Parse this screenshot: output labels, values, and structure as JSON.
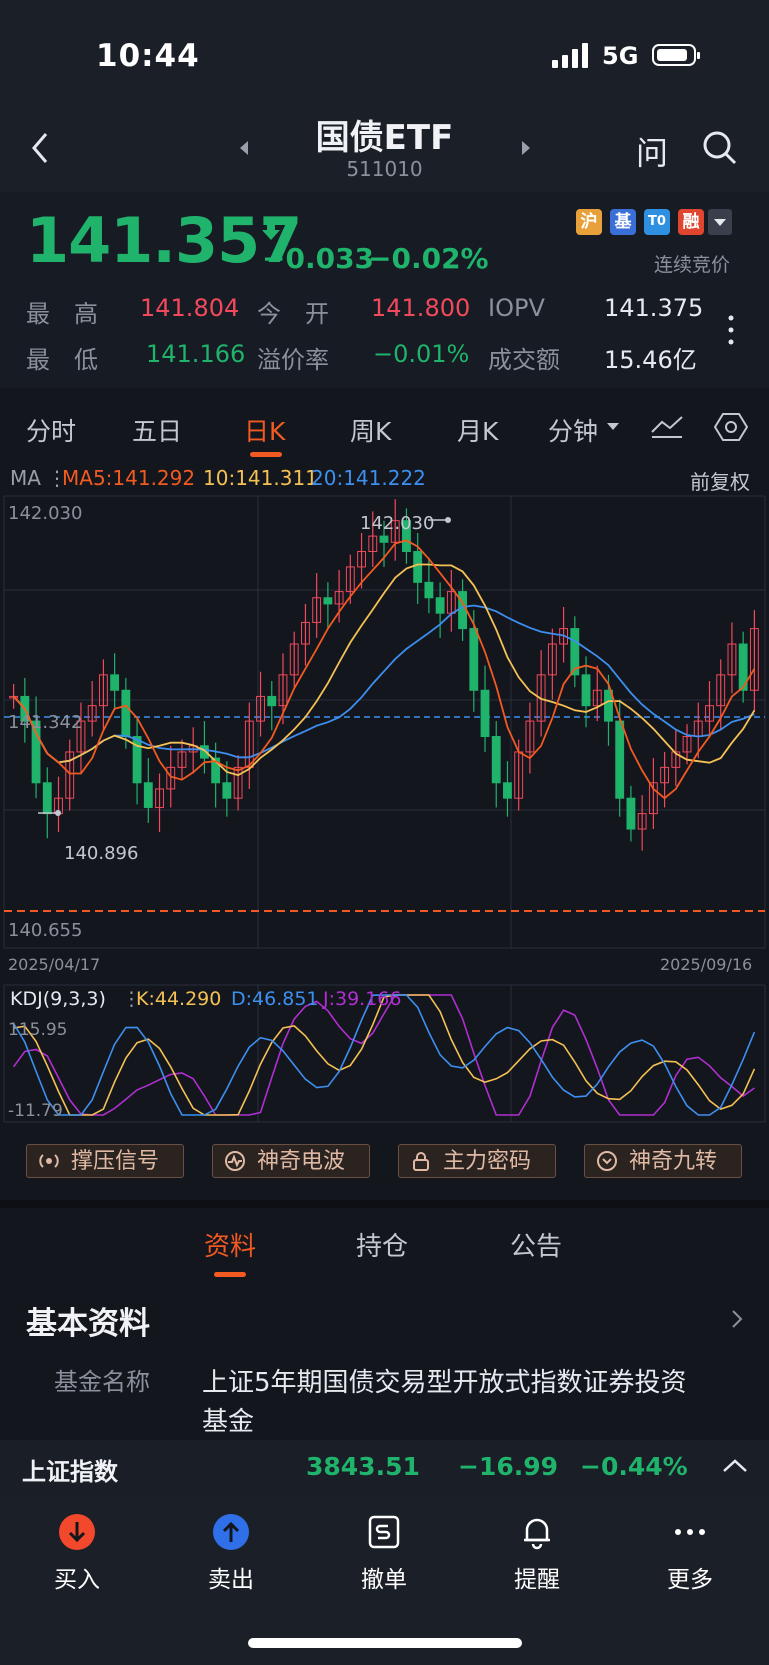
{
  "status": {
    "time": "10:44",
    "network": "5G"
  },
  "header": {
    "title": "国债ETF",
    "code": "511010",
    "ask_icon": "问",
    "search_icon": "search-icon"
  },
  "quote": {
    "price": "141.357",
    "change": "−0.033",
    "change_pct": "−0.02%",
    "badges": [
      "沪",
      "基",
      "T0",
      "融"
    ],
    "auction_label": "连续竞价",
    "stats": [
      {
        "label": "最　高",
        "value": "141.804",
        "color": "#f2495c"
      },
      {
        "label": "今　开",
        "value": "141.800",
        "color": "#f2495c"
      },
      {
        "label": "IOPV",
        "value": "141.375",
        "color": "#e6e9ef"
      },
      {
        "label": "最　低",
        "value": "141.166",
        "color": "#1fb36b"
      },
      {
        "label": "溢价率",
        "value": "−0.01%",
        "color": "#1fb36b"
      },
      {
        "label": "成交额",
        "value": "15.46亿",
        "color": "#e6e9ef"
      }
    ]
  },
  "period_tabs": [
    "分时",
    "五日",
    "日K",
    "周K",
    "月K",
    "分钟"
  ],
  "active_period": "日K",
  "ma_legend": {
    "label": "MA",
    "ma5": "MA5:141.292",
    "ma10": "10:141.311",
    "ma20": "20:141.222",
    "adjust": "前复权"
  },
  "kline": {
    "top_price": "142.030",
    "mid_price": "141.342",
    "bottom_price": "140.655",
    "high_marker": "142.030",
    "low_marker": "140.896",
    "start_date": "2025/04/17",
    "end_date": "2025/09/16"
  },
  "kdj_legend": {
    "label": "KDJ(9,3,3)",
    "k": "K:44.290",
    "d": "D:46.851",
    "j": "J:39.166",
    "top": "115.95",
    "bottom": "-11.79"
  },
  "signal_buttons": [
    "撑压信号",
    "神奇电波",
    "主力密码",
    "神奇九转"
  ],
  "info_tabs": [
    "资料",
    "持仓",
    "公告"
  ],
  "basic_info": {
    "heading": "基本资料",
    "fund_name_label": "基金名称",
    "fund_name_line1": "上证5年期国债交易型开放式指数证券投资",
    "fund_name_line2": "基金"
  },
  "index_bar": {
    "name": "上证指数",
    "value": "3843.51",
    "change": "−16.99",
    "pct": "−0.44%"
  },
  "bottom_nav": [
    "买入",
    "卖出",
    "撤单",
    "提醒",
    "更多"
  ],
  "chart_data": {
    "type": "candlestick",
    "xlabel": "",
    "ylabel": "",
    "x_range": [
      "2025/04/17",
      "2025/09/16"
    ],
    "ylim": [
      140.655,
      142.03
    ],
    "reference_line": 141.342,
    "marked_high": 142.03,
    "marked_low": 140.896,
    "close_series": [
      141.38,
      141.3,
      141.1,
      141.0,
      141.05,
      141.2,
      141.3,
      141.35,
      141.45,
      141.4,
      141.25,
      141.1,
      141.02,
      141.08,
      141.15,
      141.2,
      141.22,
      141.18,
      141.1,
      141.05,
      141.15,
      141.3,
      141.38,
      141.35,
      141.45,
      141.55,
      141.62,
      141.7,
      141.68,
      141.72,
      141.8,
      141.85,
      141.9,
      141.88,
      141.95,
      141.85,
      141.75,
      141.7,
      141.65,
      141.72,
      141.6,
      141.4,
      141.25,
      141.1,
      141.05,
      141.2,
      141.3,
      141.45,
      141.55,
      141.6,
      141.45,
      141.35,
      141.4,
      141.3,
      141.05,
      140.95,
      141.0,
      141.1,
      141.15,
      141.2,
      141.25,
      141.3,
      141.35,
      141.45,
      141.55,
      141.4,
      141.6
    ],
    "ma": [
      {
        "name": "MA5",
        "value": 141.292,
        "color": "#f25a22"
      },
      {
        "name": "10",
        "value": 141.311,
        "color": "#f5c155"
      },
      {
        "name": "20",
        "value": 141.222,
        "color": "#3d8ff0"
      }
    ],
    "kdj": {
      "K": 44.29,
      "D": 46.851,
      "J": 39.166,
      "ylim": [
        -11.79,
        115.95
      ]
    }
  }
}
